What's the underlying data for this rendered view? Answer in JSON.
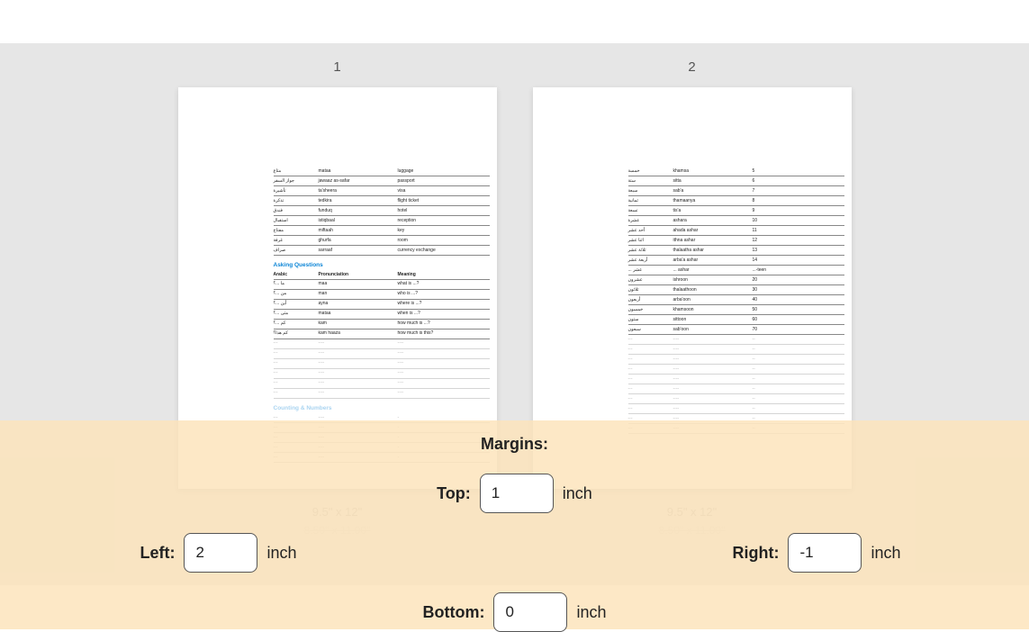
{
  "pages": {
    "p1": {
      "label": "1"
    },
    "p2": {
      "label": "2"
    }
  },
  "page1": {
    "rows_a": [
      {
        "a": "متاع",
        "p": "mataa",
        "m": "luggage"
      },
      {
        "a": "جواز السفر",
        "p": "jawaaz as-safar",
        "m": "passport"
      },
      {
        "a": "تأشيرة",
        "p": "ta'sheera",
        "m": "visa"
      },
      {
        "a": "تذكرة",
        "p": "tedkira",
        "m": "flight ticket"
      },
      {
        "a": "فندق",
        "p": "funduq",
        "m": "hotel"
      },
      {
        "a": "استقبال",
        "p": "istiqbaal",
        "m": "reception"
      },
      {
        "a": "مفتاح",
        "p": "miftaah",
        "m": "key"
      },
      {
        "a": "غرفة",
        "p": "ghurfa",
        "m": "room"
      },
      {
        "a": "صراف",
        "p": "sarraaf",
        "m": "currency exchange"
      }
    ],
    "section_b": "Asking Questions",
    "header_b": {
      "a": "Arabic",
      "p": "Pronunciation",
      "m": "Meaning"
    },
    "rows_b": [
      {
        "a": "ما ...؟",
        "p": "maa",
        "m": "what is ...?"
      },
      {
        "a": "من ...؟",
        "p": "man",
        "m": "who is ...?"
      },
      {
        "a": "أين ...؟",
        "p": "ayna",
        "m": "where is ...?"
      },
      {
        "a": "متى ...؟",
        "p": "mataa",
        "m": "when is ...?"
      },
      {
        "a": "كم ...؟",
        "p": "kam",
        "m": "how much is ...?"
      },
      {
        "a": "كم هذا؟",
        "p": "kam haaza",
        "m": "how much is this?"
      }
    ]
  },
  "page2": {
    "rows": [
      {
        "a": "خمسة",
        "p": "khamsa",
        "m": "5"
      },
      {
        "a": "ستة",
        "p": "sitta",
        "m": "6"
      },
      {
        "a": "سبعة",
        "p": "sab'a",
        "m": "7"
      },
      {
        "a": "ثمانية",
        "p": "thamaanya",
        "m": "8"
      },
      {
        "a": "تسعة",
        "p": "tis'a",
        "m": "9"
      },
      {
        "a": "عشرة",
        "p": "ashara",
        "m": "10"
      },
      {
        "a": "أحد عشر",
        "p": "ahada ashar",
        "m": "11"
      },
      {
        "a": "اثنا عشر",
        "p": "ithna ashar",
        "m": "12"
      },
      {
        "a": "ثلاثة عشر",
        "p": "thalaatha ashar",
        "m": "13"
      },
      {
        "a": "أربعة عشر",
        "p": "arba'a ashar",
        "m": "14"
      },
      {
        "a": "... عشر",
        "p": "... ashar",
        "m": "...-teen"
      },
      {
        "a": "عشرون",
        "p": "ishroon",
        "m": "20"
      },
      {
        "a": "ثلاثون",
        "p": "thalaathoon",
        "m": "30"
      },
      {
        "a": "أربعون",
        "p": "arba'oon",
        "m": "40"
      },
      {
        "a": "خمسون",
        "p": "khamsoon",
        "m": "50"
      },
      {
        "a": "ستون",
        "p": "sittoon",
        "m": "60"
      },
      {
        "a": "سبعون",
        "p": "sab'oon",
        "m": "70"
      }
    ]
  },
  "size_info": {
    "current": "9.5\" x 12\"",
    "original": "8.50\" x 11.00\""
  },
  "margins": {
    "title": "Margins:",
    "unit": "inch",
    "top_label": "Top:",
    "left_label": "Left:",
    "right_label": "Right:",
    "bottom_label": "Bottom:",
    "top": "1",
    "left": "2",
    "right": "-1",
    "bottom": "0"
  }
}
